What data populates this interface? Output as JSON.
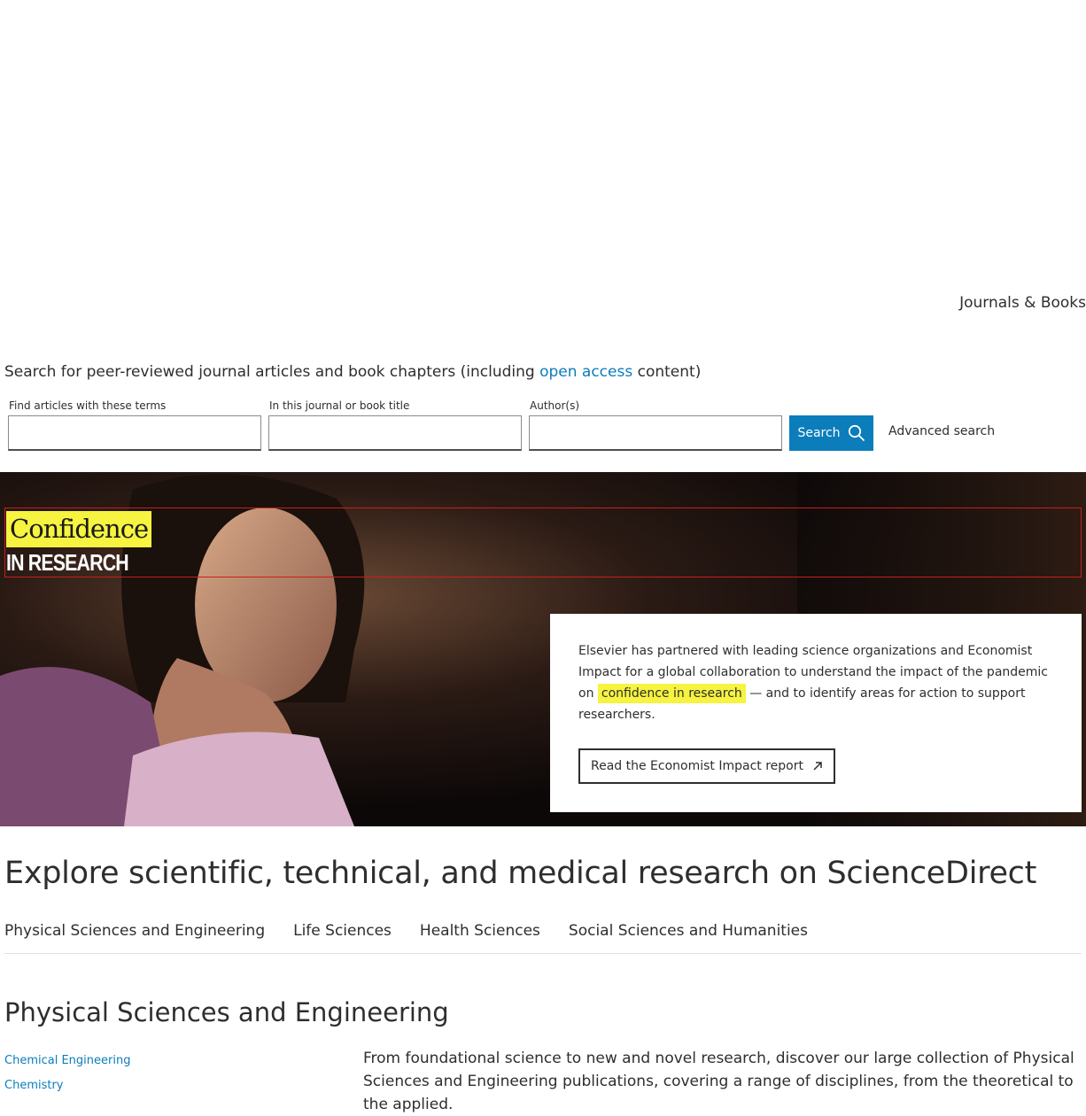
{
  "header": {
    "nav_link": "Journals & Books"
  },
  "search": {
    "intro_before": "Search for peer-reviewed journal articles and book chapters (including ",
    "intro_link": "open access",
    "intro_after": " content)",
    "fields": [
      {
        "label": "Find articles with these terms",
        "value": ""
      },
      {
        "label": "In this journal or book title",
        "value": ""
      },
      {
        "label": "Author(s)",
        "value": ""
      }
    ],
    "button_label": "Search",
    "advanced_label": "Advanced search"
  },
  "hero": {
    "badge_top": "Confidence",
    "badge_bottom": "IN RESEARCH",
    "card_text_before": "Elsevier has partnered with leading science organizations and Economist Impact for a global collaboration to understand the impact of the pandemic on ",
    "card_highlight": "confidence in research",
    "card_text_after": " — and to identify areas for action to support researchers.",
    "report_button": "Read the Economist Impact report"
  },
  "explore": {
    "title": "Explore scientific, technical, and medical research on ScienceDirect",
    "tabs": [
      "Physical Sciences and Engineering",
      "Life Sciences",
      "Health Sciences",
      "Social Sciences and Humanities"
    ]
  },
  "section": {
    "title": "Physical Sciences and Engineering",
    "subjects": [
      "Chemical Engineering",
      "Chemistry"
    ],
    "description": "From foundational science to new and novel research, discover our large collection of Physical Sciences and Engineering publications, covering a range of disciplines, from the theoretical to the applied."
  },
  "colors": {
    "accent": "#0c7dbb",
    "highlight": "#f6f341",
    "text": "#2e2e2e",
    "hero_bg": "#0c0808"
  },
  "icons": {
    "search": "search-icon",
    "external": "external-link-icon"
  }
}
